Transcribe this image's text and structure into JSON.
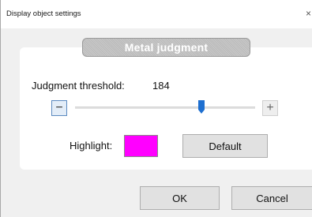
{
  "window": {
    "title": "Display object settings",
    "close_glyph": "×"
  },
  "group": {
    "title": "Metal judgment"
  },
  "threshold": {
    "label": "Judgment threshold:",
    "value": "184",
    "slider_fraction": 0.7,
    "minus_glyph": "−",
    "plus_glyph": "+"
  },
  "highlight": {
    "label": "Highlight:",
    "color": "#ff00ff"
  },
  "buttons": {
    "default": "Default",
    "ok": "OK",
    "cancel": "Cancel"
  },
  "icons": {
    "close": "close-icon",
    "minus": "minus-icon",
    "plus": "plus-icon",
    "slider_thumb": "slider-thumb"
  },
  "colors": {
    "accent": "#1e6fd0",
    "swatch": "#ff00ff",
    "header_bg": "#c2c2c2"
  }
}
